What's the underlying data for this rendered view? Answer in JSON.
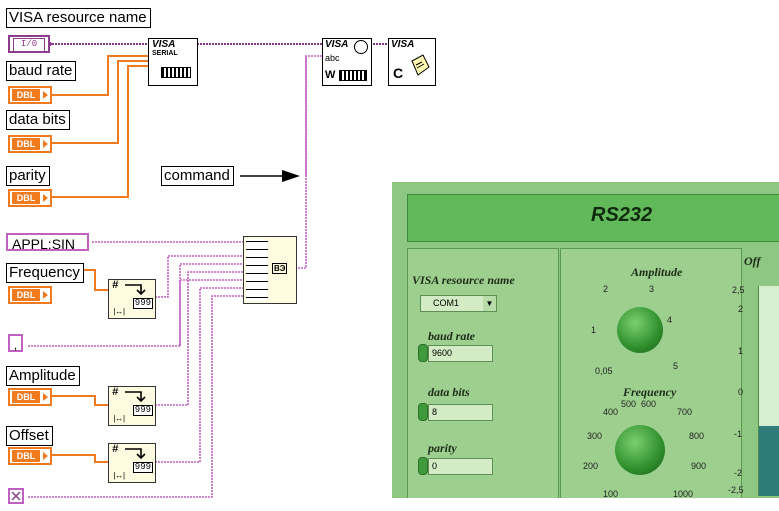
{
  "block_diagram": {
    "visa_label": "VISA resource name",
    "io_terminal": "I/0",
    "baud_label": "baud rate",
    "databits_label": "data bits",
    "parity_label": "parity",
    "dbl_tag": "DBL",
    "command_label": "command",
    "appl_constant": "APPL:SIN",
    "frequency_label": "Frequency",
    "comma_constant": ",",
    "amplitude_label": "Amplitude",
    "offset_label": "Offset",
    "serial_vi_title": "VISA",
    "serial_vi_sub": "SERIAL",
    "write_vi_title": "VISA",
    "write_vi_sub": "abc",
    "write_vi_w": "W",
    "close_vi_title": "VISA",
    "close_vi_c": "C",
    "fmt_hash": "#",
    "fmt_num": "999",
    "fmt_end": "|↔|",
    "concat_label": "ВЭ"
  },
  "front_panel": {
    "title": "RS232",
    "visa_label": "VISA resource name",
    "visa_value": "COM1",
    "baud_label": "baud rate",
    "baud_value": "9600",
    "databits_label": "data bits",
    "databits_value": "8",
    "parity_label": "parity",
    "parity_value": "0",
    "amplitude_label": "Amplitude",
    "amplitude_ticks": [
      "2",
      "3",
      "1",
      "4",
      "0,05",
      "5"
    ],
    "frequency_label": "Frequency",
    "frequency_ticks": [
      "500",
      "600",
      "400",
      "700",
      "300",
      "800",
      "200",
      "900",
      "100",
      "1000"
    ],
    "offset_label": "Off",
    "offset_ticks": [
      "2,5",
      "2",
      "1",
      "0",
      "-1",
      "-2",
      "-2,5"
    ]
  },
  "colors": {
    "wire_visa": "#8b3c8b",
    "wire_num": "#f07a1e",
    "wire_string": "#c060c0",
    "panel_bg": "#8ec781",
    "titlebar": "#62b95a",
    "knob": "#2f8f2c"
  }
}
